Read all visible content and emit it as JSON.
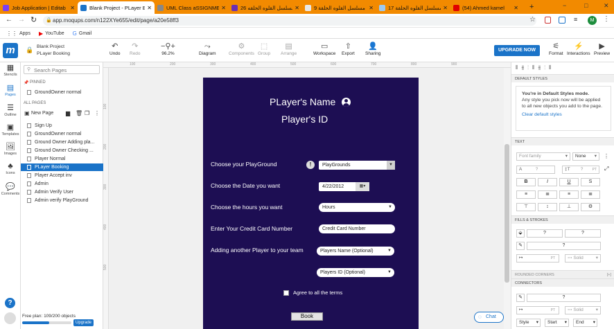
{
  "browser": {
    "tabs": [
      {
        "label": "Job Application | Editab",
        "color": "#7b3ff2"
      },
      {
        "label": "Blank Project - PLayer B",
        "color": "#1a73c8",
        "active": true
      },
      {
        "label": "UML Class aSSIGNMENT",
        "color": "#888888"
      },
      {
        "label": "مسلسل القلوه الحلقه 26",
        "color": "#6b2fb3"
      },
      {
        "label": "مسلسل القلوه الحلقة 9",
        "color": "#e8e8e8"
      },
      {
        "label": "مسلسل القلوه الحلقة 17",
        "color": "#9ec9f0"
      },
      {
        "label": "(54) Ahmed kamel",
        "color": "#e00000"
      }
    ],
    "new_tab": "+",
    "url": "app.moqups.com/n122XYe655/edit/page/a20e58ff3",
    "bookmarks": [
      {
        "label": "Apps",
        "icon": "apps-grid-icon"
      },
      {
        "label": "YouTube",
        "icon": "youtube-icon"
      },
      {
        "label": "Gmail",
        "icon": "google-icon"
      }
    ],
    "profile_initial": "M"
  },
  "app": {
    "logo": "m",
    "project_title": "Blank Project",
    "page_title": "PLayer Booking",
    "toolbar": [
      {
        "label": "Undo",
        "glyph": "↶",
        "enabled": true
      },
      {
        "label": "Redo",
        "glyph": "↷",
        "enabled": false
      },
      {
        "label": "96.2%",
        "glyph": "−⚲+",
        "enabled": true
      },
      {
        "label": "Diagram",
        "glyph": "⤳",
        "enabled": true
      },
      {
        "label": "Components",
        "glyph": "⚙",
        "enabled": false
      },
      {
        "label": "Group",
        "glyph": "⬚",
        "enabled": false
      },
      {
        "label": "Arrange",
        "glyph": "▤",
        "enabled": false
      },
      {
        "label": "Workspace",
        "glyph": "▭",
        "enabled": true
      },
      {
        "label": "Export",
        "glyph": "⇧",
        "enabled": true
      },
      {
        "label": "Sharing",
        "glyph": "👤",
        "enabled": true
      }
    ],
    "upgrade_label": "UPGRADE NOW",
    "right_tools": [
      {
        "label": "Format",
        "glyph": "⚟"
      },
      {
        "label": "Interactions",
        "glyph": "⚡"
      },
      {
        "label": "Preview",
        "glyph": "▶"
      }
    ]
  },
  "rail": [
    {
      "label": "Stencils",
      "glyph": "▦"
    },
    {
      "label": "Pages",
      "glyph": "▤",
      "selected": true
    },
    {
      "label": "Outline",
      "glyph": "☰"
    },
    {
      "label": "Templates",
      "glyph": "▣"
    },
    {
      "label": "Images",
      "glyph": "🖼"
    },
    {
      "label": "Icons",
      "glyph": "♣"
    },
    {
      "label": "Comments",
      "glyph": "💬"
    }
  ],
  "pages_panel": {
    "search_placeholder": "Search Pages",
    "pinned_label": "PINNED",
    "pinned": [
      "GroundOwner normal"
    ],
    "all_label": "ALL PAGES",
    "new_page": "New Page",
    "pages": [
      "Sign Up",
      "GroundOwner normal",
      "Ground Owner Adding pla...",
      "Ground Owner Checking ...",
      "Player Normal",
      "PLayer Booking",
      "Player Accept inv",
      "Admin",
      "Admin Verify User",
      "Admin verify PlayGround"
    ],
    "selected_index": 5,
    "plan": "Free plan: 109/200 objects",
    "plan_fraction": 0.545,
    "upgrade": "Upgrade"
  },
  "mockup": {
    "player_name": "PLayer's Name",
    "player_id": "Player's ID",
    "rows": [
      {
        "label": "Choose your PlayGround",
        "value": "PlayGrounds"
      },
      {
        "label": "Choose the Date you want",
        "value": "4/22/2012"
      },
      {
        "label": "Choose the hours you want",
        "value": "Hours"
      },
      {
        "label": "Enter Your Credit Card Number",
        "value": "Credit Card Number"
      },
      {
        "label": "Adding another Player to your team",
        "value": "Players Name (Optional)"
      }
    ],
    "players_id": "Players ID (Optional)",
    "agree": "Agree to all the terms",
    "book": "Book"
  },
  "right_panel": {
    "default_styles": "DEFAULT STYLES",
    "mode_title": "You're in Default Styles mode.",
    "mode_text": "Any style you pick now will be applied to all new objects you add to the page.",
    "clear": "Clear default styles",
    "text": "TEXT",
    "font_family": "Font family",
    "font_weight": "None",
    "q": "?",
    "fills": "FILLS & STROKES",
    "pt": "PT",
    "solid": "Solid",
    "rounded": "ROUNDED CORNERS",
    "connectors": "CONNECTORS",
    "style": "Style",
    "start": "Start",
    "end": "End"
  },
  "chat": "Chat",
  "rulers": {
    "top": [
      "100",
      "200",
      "300",
      "400",
      "500",
      "600",
      "700",
      "800",
      "900"
    ],
    "left": [
      "100",
      "200",
      "300",
      "400",
      "500"
    ]
  }
}
